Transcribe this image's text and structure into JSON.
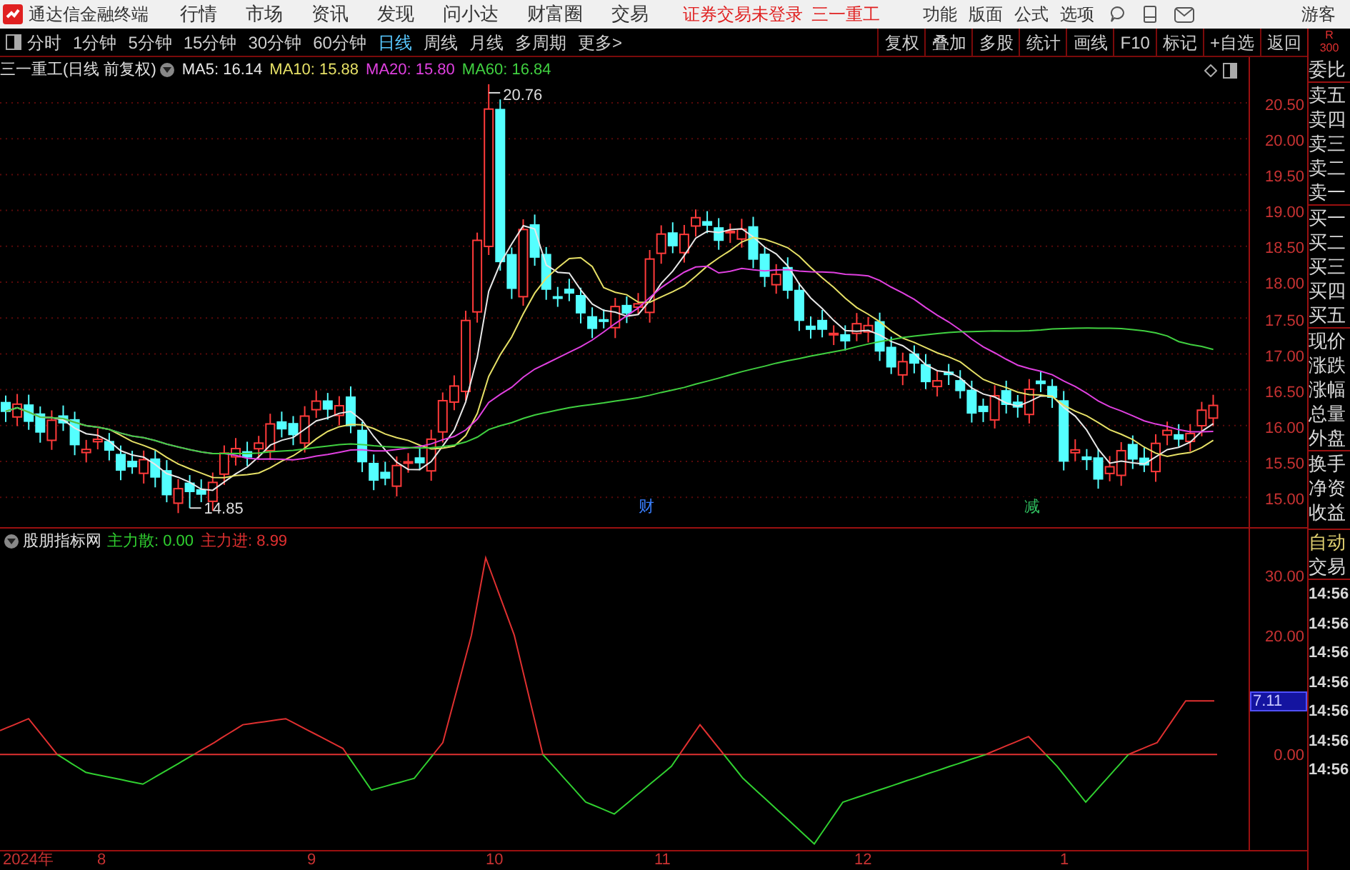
{
  "menu_bar": {
    "app_title": "通达信金融终端",
    "items": [
      "行情",
      "市场",
      "资讯",
      "发现",
      "问小达",
      "财富圈",
      "交易"
    ],
    "login_status": "证券交易未登录",
    "stock_name": "三一重工",
    "right_items": [
      "功能",
      "版面",
      "公式",
      "选项"
    ],
    "user": "游客"
  },
  "period_tabs": [
    {
      "label": "分时",
      "selected": false
    },
    {
      "label": "1分钟",
      "selected": false
    },
    {
      "label": "5分钟",
      "selected": false
    },
    {
      "label": "15分钟",
      "selected": false
    },
    {
      "label": "30分钟",
      "selected": false
    },
    {
      "label": "60分钟",
      "selected": false
    },
    {
      "label": "日线",
      "selected": true
    },
    {
      "label": "周线",
      "selected": false
    },
    {
      "label": "月线",
      "selected": false
    },
    {
      "label": "多周期",
      "selected": false
    },
    {
      "label": "更多>",
      "selected": false
    }
  ],
  "tool_buttons": [
    "复权",
    "叠加",
    "多股",
    "统计",
    "画线",
    "F10",
    "标记",
    "+自选",
    "返回"
  ],
  "chart_header": {
    "title": "三一重工(日线 前复权)",
    "indicators": [
      {
        "label": "MA5: 16.14",
        "color": "#e8e8e8"
      },
      {
        "label": "MA10: 15.88",
        "color": "#e6e066"
      },
      {
        "label": "MA20: 15.80",
        "color": "#e040e0"
      },
      {
        "label": "MA60: 16.84",
        "color": "#40d040"
      }
    ]
  },
  "price_axis": [
    "20.50",
    "20.00",
    "19.50",
    "19.00",
    "18.50",
    "18.00",
    "17.50",
    "17.00",
    "16.50",
    "16.00",
    "15.50",
    "15.00"
  ],
  "annotations": {
    "high": "20.76",
    "low": "14.85",
    "badges": [
      {
        "label": "财",
        "color": "#3a7fff"
      },
      {
        "label": "减",
        "color": "#30c060"
      }
    ]
  },
  "indicator": {
    "name": "股朋指标网",
    "series": [
      {
        "label": "主力散: 0.00",
        "color": "#30d030"
      },
      {
        "label": "主力进: 8.99",
        "color": "#e03030"
      }
    ],
    "axis": [
      "30.00",
      "20.00",
      "0.00"
    ],
    "marker": "7.11"
  },
  "time_axis": [
    "2024年",
    "8",
    "9",
    "10",
    "11",
    "12",
    "1"
  ],
  "side_panel": {
    "badge": "R",
    "badge_value": "300",
    "labels": [
      "委比",
      "卖五",
      "卖四",
      "卖三",
      "卖二",
      "卖一",
      "买一",
      "买二",
      "买三",
      "买四",
      "买五",
      "现价",
      "涨跌",
      "涨幅",
      "总量",
      "外盘",
      "换手",
      "净资",
      "收益"
    ],
    "trade_title": [
      "自动",
      "交易"
    ],
    "times": [
      "14:56",
      "14:56",
      "14:56",
      "14:56",
      "14:56",
      "14:56",
      "14:56"
    ]
  }
}
